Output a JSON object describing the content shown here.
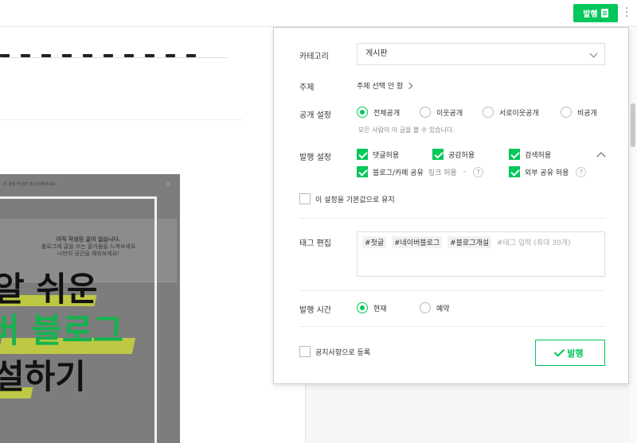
{
  "topbar": {
    "publish_label": "발행"
  },
  "thumbnail": {
    "small_text": "이 글을 작성할 때 유의해주세요",
    "card_line1": "아직 작성된 글이 없습니다.",
    "card_line2": "블로그에 글을 쓰는 즐거움을 느껴보세요",
    "card_line3": "나만의 공간을 채워보세요!",
    "big_line1": "알 쉬운",
    "big_line2": "버 블로그",
    "big_line3": "설하기"
  },
  "dialog": {
    "category": {
      "label": "카테고리",
      "value": "게시판"
    },
    "topic": {
      "label": "주제",
      "value": "주제 선택 안 함"
    },
    "visibility": {
      "label": "공개 설정",
      "options": [
        "전체공개",
        "이웃공개",
        "서로이웃공개",
        "비공개"
      ],
      "selected": "전체공개",
      "hint": "모든 사람이 이 글을 볼 수 있습니다."
    },
    "publish_settings": {
      "label": "발행 설정",
      "comment": "댓글허용",
      "like": "공감허용",
      "search": "검색허용",
      "share": "블로그/카페 공유",
      "share_link": "링크 허용",
      "share_dash": "-",
      "external": "외부 공유 허용",
      "help": "?"
    },
    "keep_default": "이 설정을 기본값으로 유지",
    "tags": {
      "label": "태그 편집",
      "items": [
        "#첫글",
        "#네이버블로그",
        "#블로그개설"
      ],
      "placeholder": "#태그 입력 (최대 30개)"
    },
    "publish_time": {
      "label": "발행 시간",
      "options": [
        "현재",
        "예약"
      ],
      "selected": "현재"
    },
    "notice": "공지사항으로 등록",
    "confirm_label": "발행"
  },
  "colors": {
    "accent": "#03c75a"
  }
}
